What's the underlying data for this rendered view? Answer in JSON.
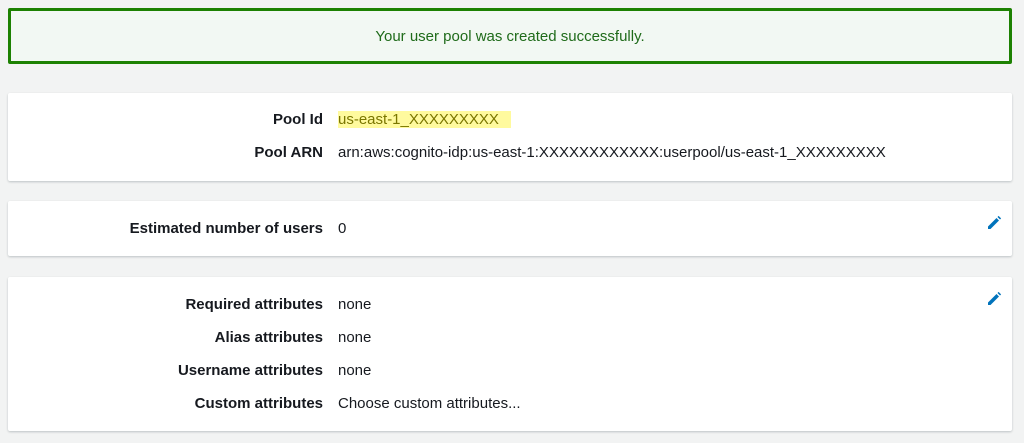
{
  "banner": {
    "message": "Your user pool was created successfully."
  },
  "pool": {
    "id_label": "Pool Id",
    "id_value": "us-east-1_XXXXXXXXX",
    "arn_label": "Pool ARN",
    "arn_value": "arn:aws:cognito-idp:us-east-1:XXXXXXXXXXXX:userpool/us-east-1_XXXXXXXXX"
  },
  "users": {
    "label": "Estimated number of users",
    "value": "0"
  },
  "attributes": {
    "required_label": "Required attributes",
    "required_value": "none",
    "alias_label": "Alias attributes",
    "alias_value": "none",
    "username_label": "Username attributes",
    "username_value": "none",
    "custom_label": "Custom attributes",
    "custom_link": "Choose custom attributes..."
  },
  "colors": {
    "success": "#1d8102",
    "link": "#0073bb",
    "highlight": "#fffa9e",
    "edit_icon": "#0073bb"
  }
}
